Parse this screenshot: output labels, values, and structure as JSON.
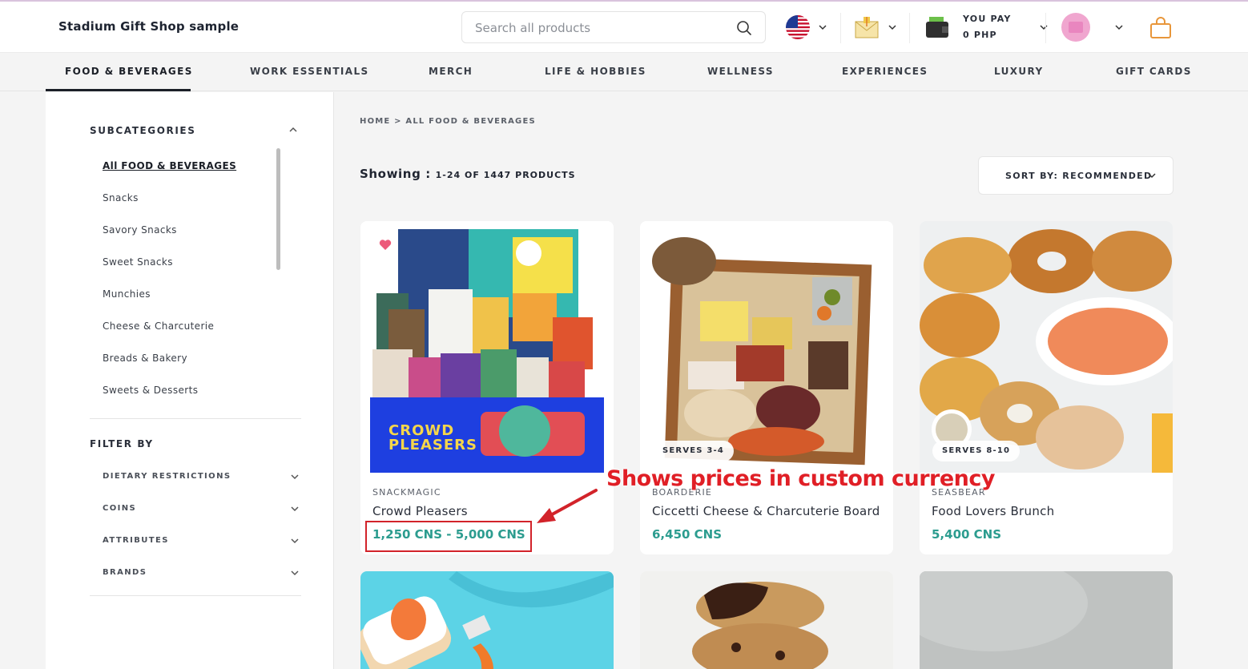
{
  "header": {
    "brand": "Stadium Gift Shop sample",
    "search_placeholder": "Search all products",
    "you_pay_label": "YOU PAY",
    "you_pay_value": "0 PHP"
  },
  "nav": {
    "items": [
      "FOOD & BEVERAGES",
      "WORK ESSENTIALS",
      "MERCH",
      "LIFE & HOBBIES",
      "WELLNESS",
      "EXPERIENCES",
      "LUXURY",
      "GIFT CARDS"
    ]
  },
  "sidebar": {
    "subcategories_heading": "SUBCATEGORIES",
    "subcategories": [
      "All FOOD & BEVERAGES",
      "Snacks",
      "Savory Snacks",
      "Sweet Snacks",
      "Munchies",
      "Cheese & Charcuterie",
      "Breads & Bakery",
      "Sweets & Desserts"
    ],
    "filter_heading": "FILTER BY",
    "filters": [
      "DIETARY RESTRICTIONS",
      "COINS",
      "ATTRIBUTES",
      "BRANDS"
    ]
  },
  "listing": {
    "breadcrumb": "HOME > ALL FOOD & BEVERAGES",
    "showing_label": "Showing :",
    "showing_count": "1-24 OF 1447 PRODUCTS",
    "sort_label": "SORT BY: RECOMMENDED"
  },
  "products": [
    {
      "brand": "SNACKMAGIC",
      "name": "Crowd Pleasers",
      "price": "1,250 CNS - 5,000 CNS",
      "box_text_1": "CROWD",
      "box_text_2": "PLEASERS"
    },
    {
      "brand": "BOARDERIE",
      "name": "Ciccetti Cheese & Charcuterie Board",
      "price": "6,450 CNS",
      "serves": "SERVES 3-4"
    },
    {
      "brand": "SEASBEAR",
      "name": "Food Lovers Brunch",
      "price": "5,400 CNS",
      "serves": "SERVES 8-10"
    }
  ],
  "annotation": {
    "text": "Shows prices in custom currency"
  },
  "colors": {
    "price": "#2c9c8f",
    "annotation": "#e01f26",
    "cart": "#e8963a"
  }
}
